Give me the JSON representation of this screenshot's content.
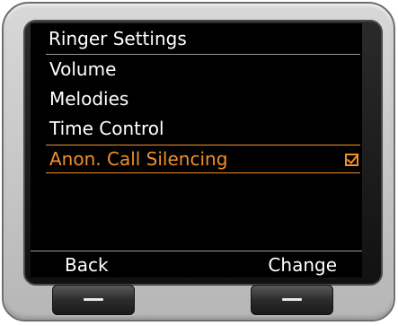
{
  "screen": {
    "title": "Ringer Settings",
    "menu": [
      {
        "label": "Volume",
        "selected": false
      },
      {
        "label": "Melodies",
        "selected": false
      },
      {
        "label": "Time Control",
        "selected": false
      },
      {
        "label": "Anon. Call Silencing",
        "selected": true,
        "checked": true
      }
    ],
    "softkeys": {
      "left": "Back",
      "right": "Change"
    }
  },
  "icons": {
    "checkbox": "checkbox-checked-icon",
    "hardware_button_mark": "dash-icon"
  },
  "colors": {
    "highlight": "#f0902a",
    "screen_background": "#000000",
    "text": "#ffffff"
  }
}
